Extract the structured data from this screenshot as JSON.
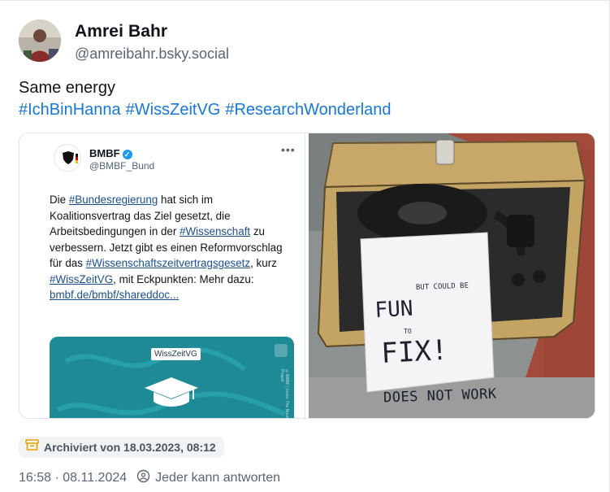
{
  "author": {
    "name": "Amrei Bahr",
    "handle": "@amreibahr.bsky.social",
    "avatar_icon": "profile-photo"
  },
  "post": {
    "text": "Same energy",
    "hashtags": [
      "#IchBinHanna",
      "#WissZeitVG",
      "#ResearchWonderland"
    ]
  },
  "embedded_tweet": {
    "name": "BMBF",
    "handle": "@BMBF_Bund",
    "more": "•••",
    "body_segments": [
      {
        "t": "Die ",
        "link": false
      },
      {
        "t": "#Bundesregierung",
        "link": true
      },
      {
        "t": " hat sich im Koalitionsvertrag das Ziel gesetzt, die Arbeitsbedingungen in der ",
        "link": false
      },
      {
        "t": "#Wissenschaft",
        "link": true
      },
      {
        "t": " zu verbessern. Jetzt gibt es einen Reformvorschlag für das ",
        "link": false
      },
      {
        "t": "#Wissenschaftszeitvertragsgesetz",
        "link": true
      },
      {
        "t": ", kurz ",
        "link": false
      },
      {
        "t": "#WissZeitVG",
        "link": true
      },
      {
        "t": ", mit Eckpunkten: Mehr dazu: ",
        "link": false
      },
      {
        "t": "bmbf.de/bmbf/shareddoc...",
        "link": true
      }
    ],
    "card_label": "WissZeitVG",
    "card_side_text": "©BMBF | Icons: The Noun Project"
  },
  "photo": {
    "sign_line1": "DOES NOT WORK",
    "sign_line2": "BUT COULD BE",
    "sign_line3": "FUN",
    "sign_line4": "TO",
    "sign_line5": "FIX!"
  },
  "archive": {
    "icon": "archive-box-icon",
    "label": "Archiviert von 18.03.2023, 08:12"
  },
  "footer": {
    "timestamp": "16:58 · 08.11.2024",
    "reply_icon": "reply-settings-icon",
    "reply_setting": "Jeder kann antworten"
  },
  "colors": {
    "link": "#1877d6",
    "muted": "#5b6672",
    "card_teal": "#1e8a96"
  }
}
